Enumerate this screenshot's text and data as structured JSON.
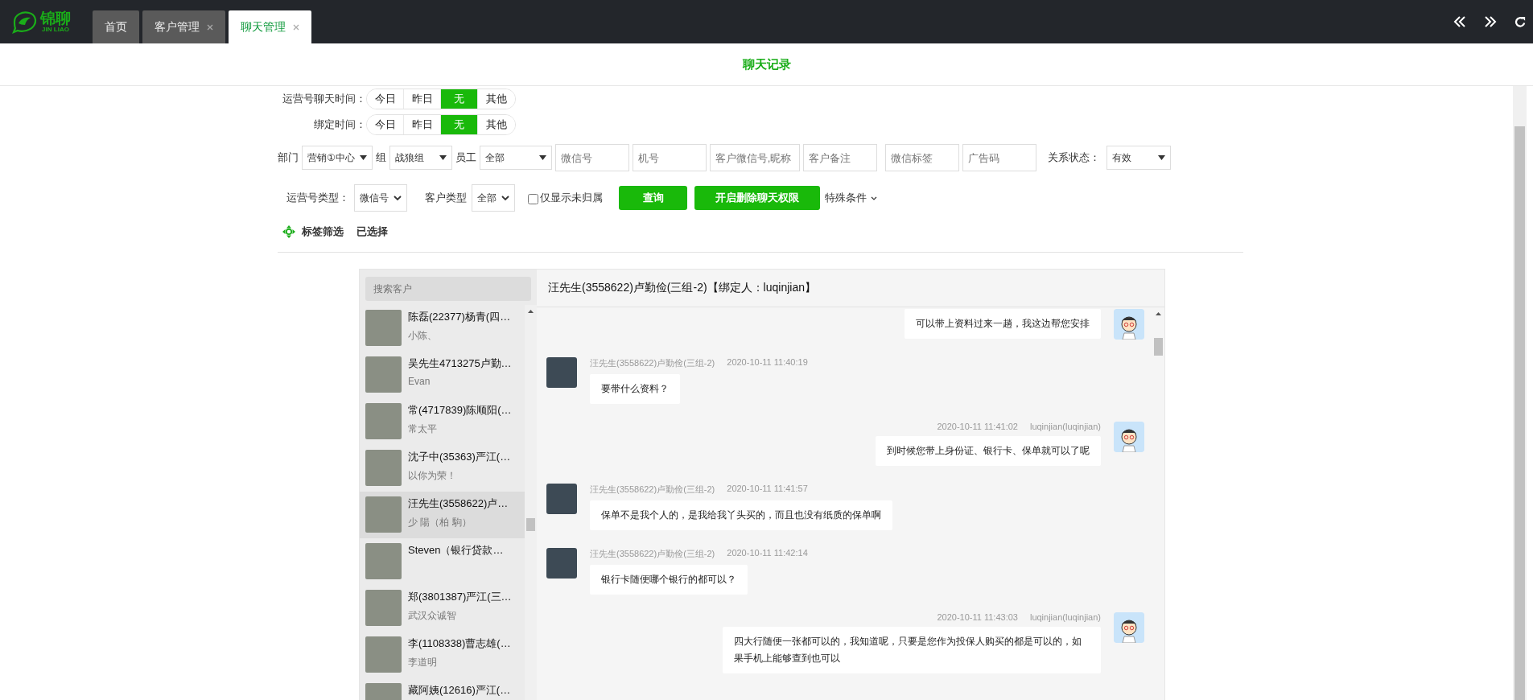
{
  "logo": {
    "name": "锦聊",
    "subtitle": "JIN LIAO"
  },
  "tabs": [
    {
      "label": "首页",
      "selected": false,
      "closable": false
    },
    {
      "label": "客户管理",
      "selected": false,
      "closable": true
    },
    {
      "label": "聊天管理",
      "selected": true,
      "closable": true
    }
  ],
  "page_title": "聊天记录",
  "time_filters": [
    {
      "label": "运营号聊天时间：",
      "options": [
        {
          "label": "今日",
          "selected": false
        },
        {
          "label": "昨日",
          "selected": false
        },
        {
          "label": "无",
          "selected": true
        },
        {
          "label": "其他",
          "selected": false
        }
      ]
    },
    {
      "label": "绑定时间：",
      "options": [
        {
          "label": "今日",
          "selected": false
        },
        {
          "label": "昨日",
          "selected": false
        },
        {
          "label": "无",
          "selected": true
        },
        {
          "label": "其他",
          "selected": false
        }
      ]
    }
  ],
  "filter_row": [
    {
      "kind": "select",
      "label": "部门",
      "value": "营销①中心"
    },
    {
      "kind": "select",
      "label": "组",
      "value": "战狼组"
    },
    {
      "kind": "select",
      "label": "员工",
      "value": "全部"
    },
    {
      "kind": "input",
      "placeholder": "微信号"
    },
    {
      "kind": "input",
      "placeholder": "机号"
    },
    {
      "kind": "input",
      "placeholder": "客户微信号,昵称"
    },
    {
      "kind": "input",
      "placeholder": "客户备注"
    },
    {
      "kind": "input",
      "placeholder": "微信标签"
    },
    {
      "kind": "input",
      "placeholder": "广告码"
    },
    {
      "kind": "select",
      "label": "关系状态：",
      "value": "有效"
    }
  ],
  "second_row": {
    "account_type": {
      "label": "运营号类型：",
      "value": "微信号"
    },
    "customer_type": {
      "label": "客户类型",
      "value": "全部"
    },
    "unassigned_only": {
      "label": "仅显示未归属",
      "checked": false
    },
    "buttons": [
      "查询",
      "开启删除聊天权限"
    ],
    "special": "特殊条件"
  },
  "tag_filter": {
    "label": "标签筛选",
    "selected_label": "已选择"
  },
  "contact_search": {
    "placeholder": "搜索客户"
  },
  "contacts": [
    {
      "name": "陈磊(22377)杨青(四…",
      "remark": "小陈、",
      "selected": false
    },
    {
      "name": "吴先生4713275卢勤…",
      "remark": "Evan",
      "selected": false
    },
    {
      "name": "常(4717839)陈顺阳(…",
      "remark": "常太平",
      "selected": false
    },
    {
      "name": "沈子中(35363)严江(…",
      "remark": "以你为荣！",
      "selected": false
    },
    {
      "name": "汪先生(3558622)卢…",
      "remark": "少 陽（柏 駒）",
      "selected": true
    },
    {
      "name": "Steven（银行贷款…",
      "selected": false
    },
    {
      "name": "郑(3801387)严江(三…",
      "remark": "武汉众诚智",
      "selected": false
    },
    {
      "name": "李(1108338)曹志雄(…",
      "remark": "李道明",
      "selected": false
    },
    {
      "name": "藏阿姨(12616)严江(…",
      "selected": false
    }
  ],
  "chat_title": "汪先生(3558622)卢勤俭(三组-2)【绑定人：luqinjian】",
  "messages": [
    {
      "kind": "agent",
      "text": "可以带上资料过来一趟，我这边帮您安排"
    },
    {
      "kind": "customer",
      "sender": "汪先生(3558622)卢勤俭(三组-2)",
      "time": "2020-10-11 11:40:19",
      "text": "要带什么资料？"
    },
    {
      "kind": "agent",
      "sender": "luqinjian(luqinjian)",
      "time": "2020-10-11 11:41:02",
      "text": "到时候您带上身份证、银行卡、保单就可以了呢"
    },
    {
      "kind": "customer",
      "sender": "汪先生(3558622)卢勤俭(三组-2)",
      "time": "2020-10-11 11:41:57",
      "text": "保单不是我个人的，是我给我丫头买的，而且也没有纸质的保单啊"
    },
    {
      "kind": "customer",
      "sender": "汪先生(3558622)卢勤俭(三组-2)",
      "time": "2020-10-11 11:42:14",
      "text": "银行卡随便哪个银行的都可以？"
    },
    {
      "kind": "agent",
      "sender": "luqinjian(luqinjian)",
      "time": "2020-10-11 11:43:03",
      "text": "四大行随便一张都可以的，我知道呢，只要是您作为投保人购买的都是可以的，如果手机上能够查到也可以"
    }
  ]
}
